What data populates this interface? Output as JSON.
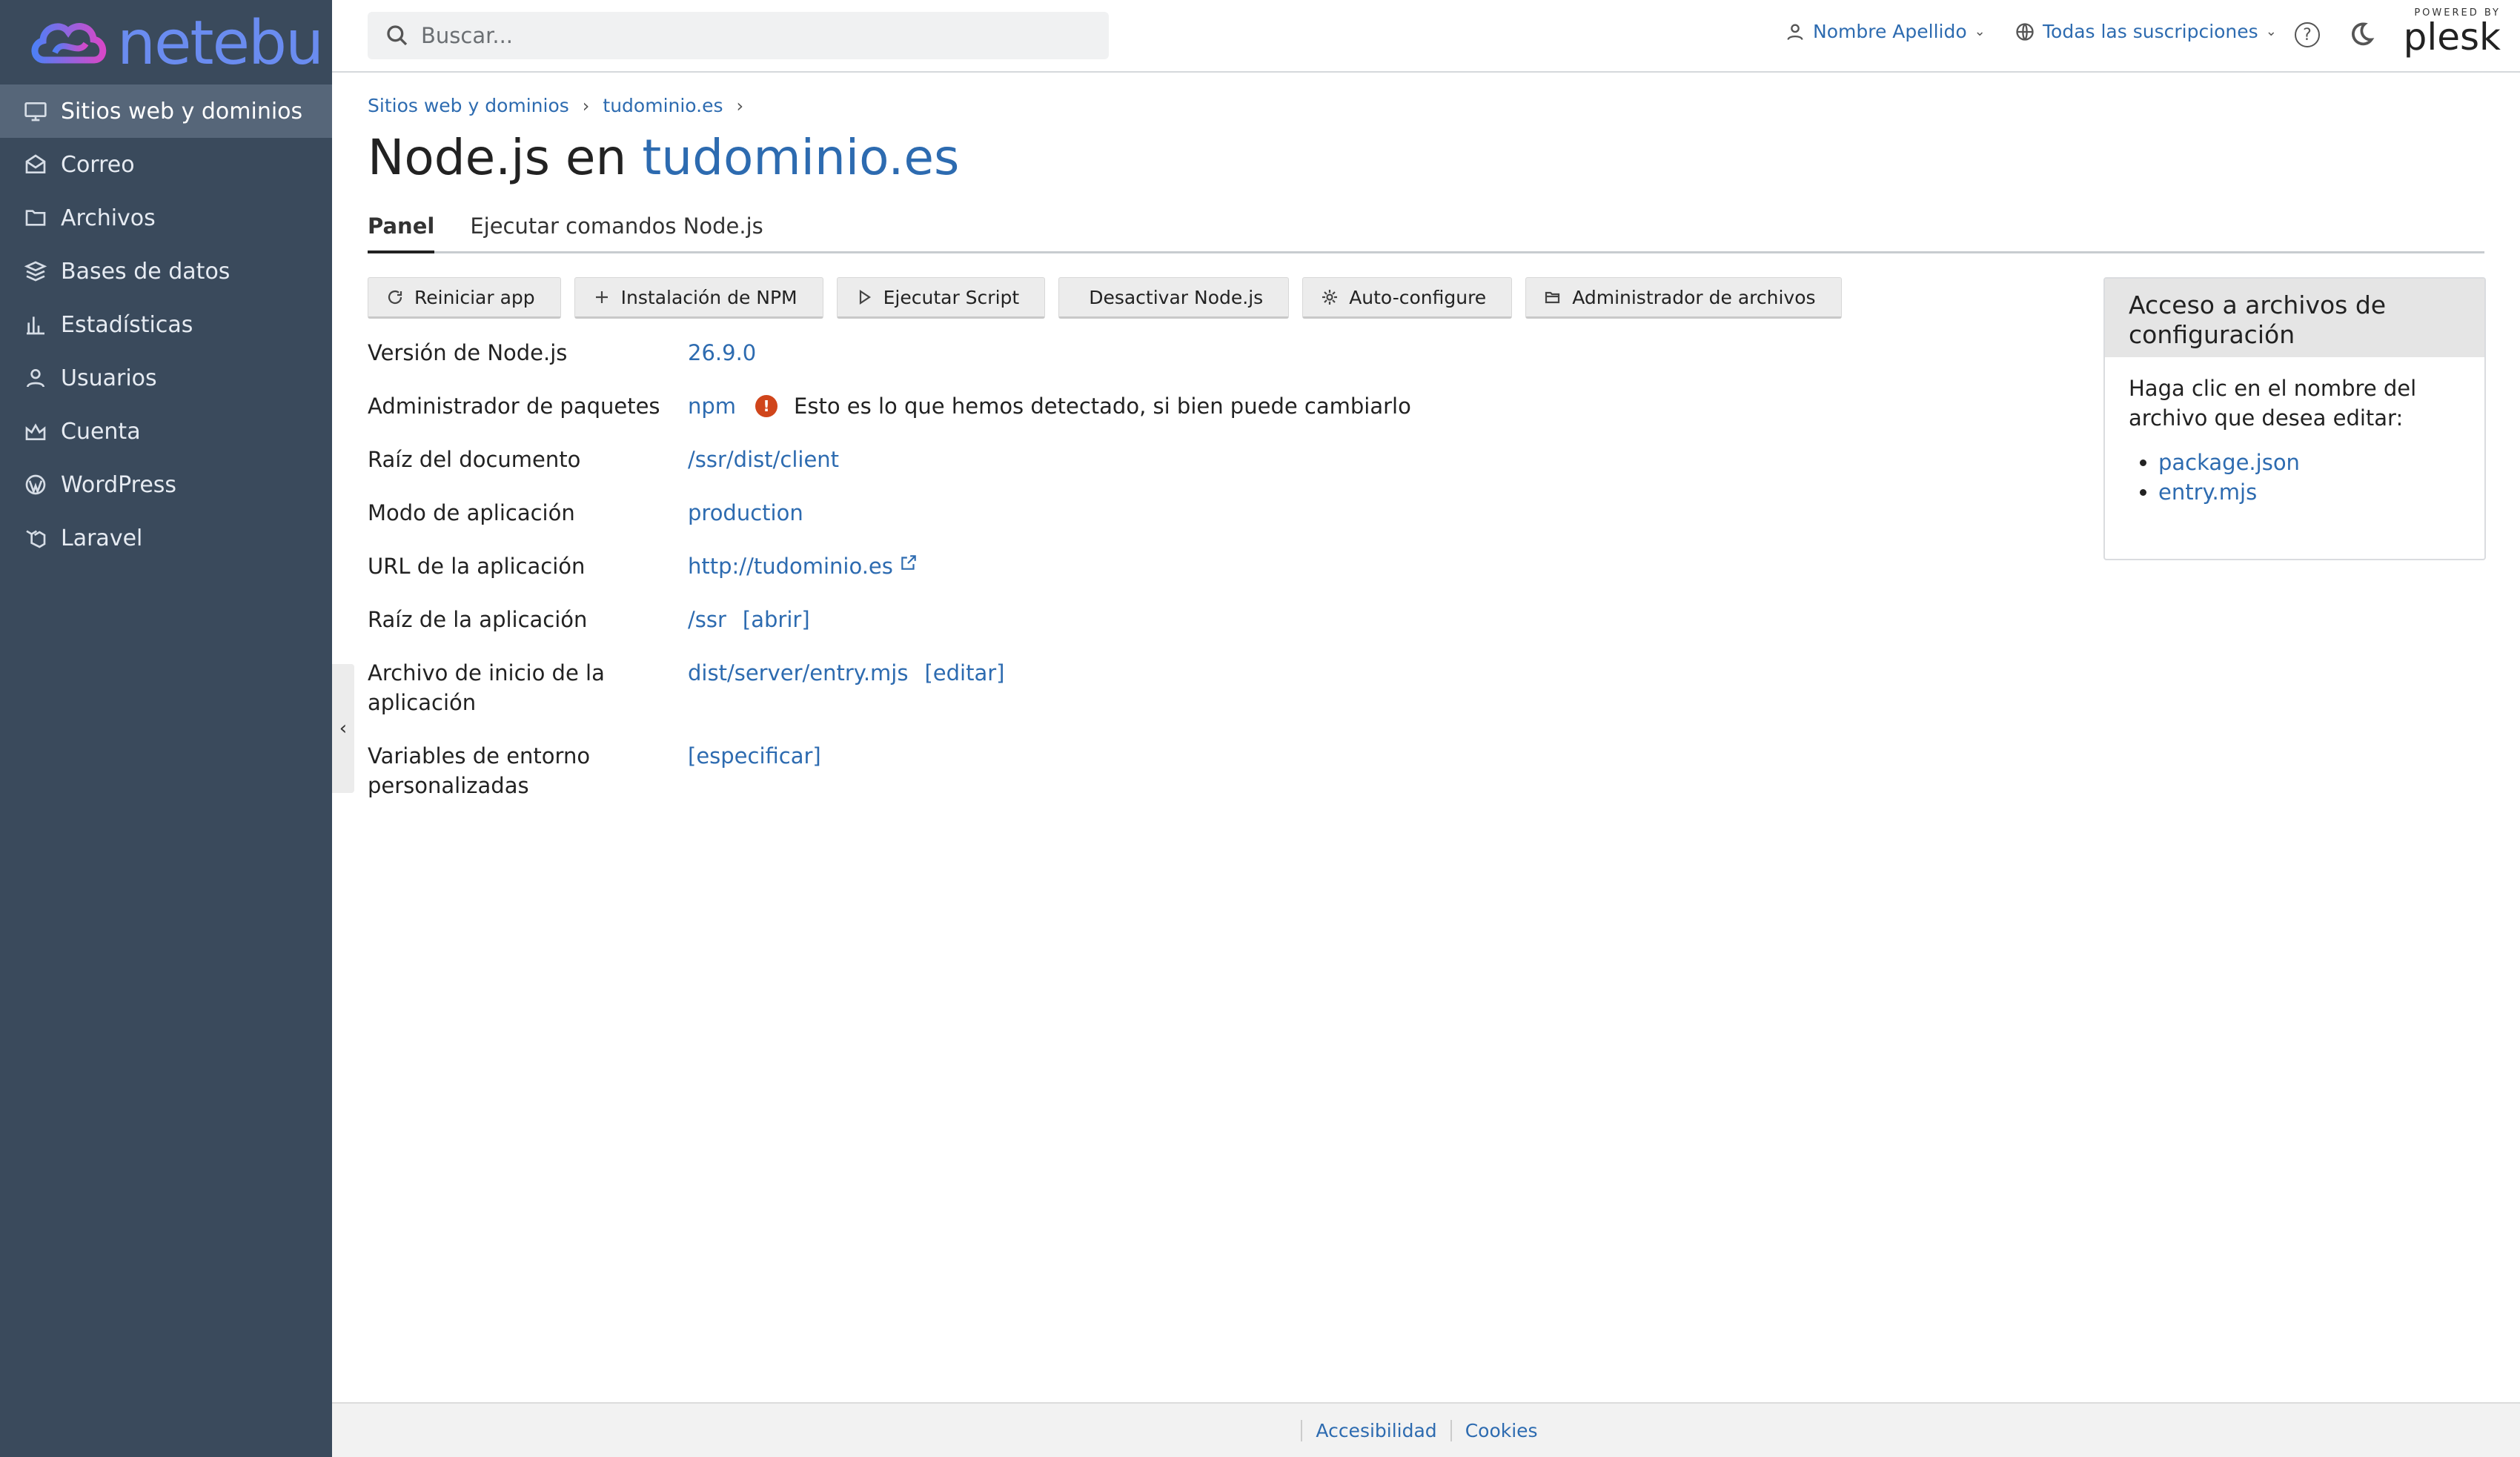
{
  "brand": {
    "name": "netebu"
  },
  "sidebar": {
    "items": [
      {
        "label": "Sitios web y dominios",
        "icon": "monitor-icon"
      },
      {
        "label": "Correo",
        "icon": "mail-icon"
      },
      {
        "label": "Archivos",
        "icon": "folder-icon"
      },
      {
        "label": "Bases de datos",
        "icon": "database-icon"
      },
      {
        "label": "Estadísticas",
        "icon": "chart-icon"
      },
      {
        "label": "Usuarios",
        "icon": "user-icon"
      },
      {
        "label": "Cuenta",
        "icon": "account-icon"
      },
      {
        "label": "WordPress",
        "icon": "wordpress-icon"
      },
      {
        "label": "Laravel",
        "icon": "laravel-icon"
      }
    ]
  },
  "header": {
    "search_placeholder": "Buscar...",
    "user_name": "Nombre Apellido",
    "subscriptions": "Todas las suscripciones",
    "powered_small": "POWERED BY",
    "powered_big": "plesk"
  },
  "breadcrumb": [
    "Sitios web y dominios",
    "tudominio.es"
  ],
  "title": {
    "prefix": "Node.js en",
    "domain": "tudominio.es"
  },
  "tabs": [
    "Panel",
    "Ejecutar comandos Node.js"
  ],
  "toolbar": {
    "restart": "Reiniciar app",
    "npm_install": "Instalación de NPM",
    "run_script": "Ejecutar Script",
    "disable": "Desactivar Node.js",
    "autoconfigure": "Auto-configure",
    "file_manager": "Administrador de archivos"
  },
  "props": {
    "version": {
      "label": "Versión de Node.js",
      "value": "26.9.0"
    },
    "pkg_manager": {
      "label": "Administrador de paquetes",
      "value": "npm",
      "note": "Esto es lo que hemos detectado, si bien puede cambiarlo"
    },
    "doc_root": {
      "label": "Raíz del documento",
      "value": "/ssr/dist/client"
    },
    "app_mode": {
      "label": "Modo de aplicación",
      "value": "production"
    },
    "app_url": {
      "label": "URL de la aplicación",
      "value": "http://tudominio.es"
    },
    "app_root": {
      "label": "Raíz de la aplicación",
      "value": "/ssr",
      "action": "[abrir]"
    },
    "startup_file": {
      "label": "Archivo de inicio de la aplicación",
      "value": "dist/server/entry.mjs",
      "action": "[editar]"
    },
    "env_vars": {
      "label": "Variables de entorno personalizadas",
      "action": "[especificar]"
    }
  },
  "side_panel": {
    "title": "Acceso a archivos de configuración",
    "text": "Haga clic en el nombre del archivo que desea editar:",
    "files": [
      "package.json",
      "entry.mjs"
    ]
  },
  "footer": {
    "accessibility": "Accesibilidad",
    "cookies": "Cookies"
  }
}
